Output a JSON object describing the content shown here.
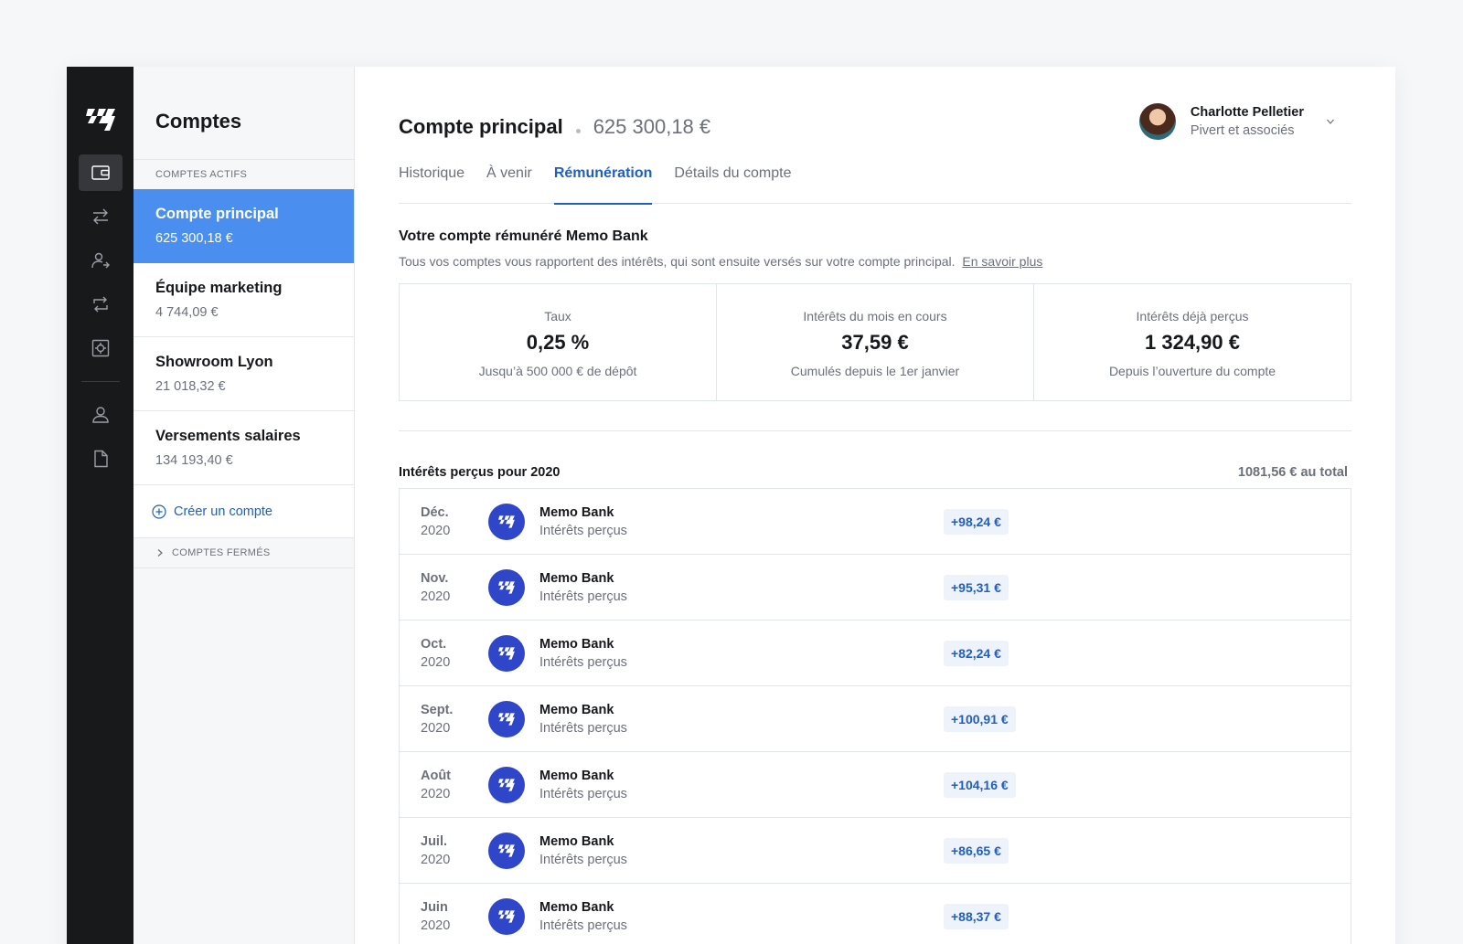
{
  "nav": {
    "items": [
      {
        "icon": "wallet-icon",
        "active": true
      },
      {
        "icon": "transfer-icon",
        "active": false
      },
      {
        "icon": "beneficiaries-icon",
        "active": false
      },
      {
        "icon": "recurring-icon",
        "active": false
      },
      {
        "icon": "card-icon",
        "active": false
      },
      {
        "icon": "user-icon",
        "active": false
      },
      {
        "icon": "document-icon",
        "active": false
      }
    ]
  },
  "accounts": {
    "title": "Comptes",
    "active_label": "COMPTES ACTIFS",
    "items": [
      {
        "name": "Compte principal",
        "balance": "625 300,18 €",
        "active": true
      },
      {
        "name": "Équipe marketing",
        "balance": "4 744,09 €",
        "active": false
      },
      {
        "name": "Showroom Lyon",
        "balance": "21 018,32 €",
        "active": false
      },
      {
        "name": "Versements salaires",
        "balance": "134 193,40 €",
        "active": false
      }
    ],
    "create_label": "Créer un compte",
    "closed_label": "COMPTES FERMÉS"
  },
  "header": {
    "title": "Compte principal",
    "balance": "625 300,18 €"
  },
  "user": {
    "name": "Charlotte Pelletier",
    "company": "Pivert et associés"
  },
  "tabs": [
    {
      "label": "Historique",
      "active": false
    },
    {
      "label": "À venir",
      "active": false
    },
    {
      "label": "Rémunération",
      "active": true
    },
    {
      "label": "Détails du compte",
      "active": false
    }
  ],
  "intro": {
    "title": "Votre compte rémunéré Memo Bank",
    "description": "Tous vos comptes vous rapportent des intérêts, qui sont ensuite versés sur votre compte principal.",
    "link": "En savoir plus"
  },
  "stats": [
    {
      "label": "Taux",
      "value": "0,25 %",
      "sub": "Jusqu’à 500 000 € de dépôt"
    },
    {
      "label": "Intérêts du mois en cours",
      "value": "37,59 €",
      "sub": "Cumulés depuis le 1er janvier"
    },
    {
      "label": "Intérêts déjà perçus",
      "value": "1 324,90 €",
      "sub": "Depuis l’ouverture du compte"
    }
  ],
  "interests": {
    "title": "Intérêts perçus pour 2020",
    "total": "1081,56 € au total",
    "rows": [
      {
        "month": "Déc.",
        "year": "2020",
        "bank": "Memo Bank",
        "desc": "Intérêts perçus",
        "amount": "+98,24 €"
      },
      {
        "month": "Nov.",
        "year": "2020",
        "bank": "Memo Bank",
        "desc": "Intérêts perçus",
        "amount": "+95,31 €"
      },
      {
        "month": "Oct.",
        "year": "2020",
        "bank": "Memo Bank",
        "desc": "Intérêts perçus",
        "amount": "+82,24 €"
      },
      {
        "month": "Sept.",
        "year": "2020",
        "bank": "Memo Bank",
        "desc": "Intérêts perçus",
        "amount": "+100,91 €"
      },
      {
        "month": "Août",
        "year": "2020",
        "bank": "Memo Bank",
        "desc": "Intérêts perçus",
        "amount": "+104,16 €"
      },
      {
        "month": "Juil.",
        "year": "2020",
        "bank": "Memo Bank",
        "desc": "Intérêts perçus",
        "amount": "+86,65 €"
      },
      {
        "month": "Juin",
        "year": "2020",
        "bank": "Memo Bank",
        "desc": "Intérêts perçus",
        "amount": "+88,37 €"
      }
    ]
  },
  "colors": {
    "accent": "#1f5fbf",
    "active_account": "#4a8ff0",
    "rail": "#18191b",
    "bank_logo": "#2f46c8"
  }
}
